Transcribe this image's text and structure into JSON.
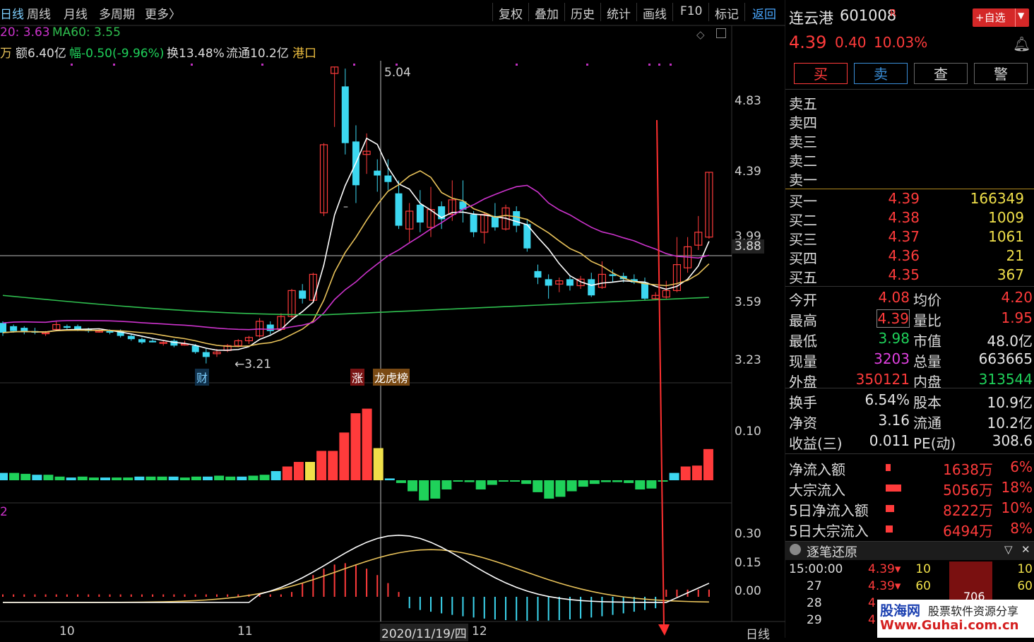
{
  "toolbar": {
    "tabs": [
      "日线",
      "周线",
      "月线",
      "多周期",
      "更多〉"
    ],
    "right_buttons": [
      "复权",
      "叠加",
      "历史",
      "统计",
      "画线",
      "F10",
      "标记",
      "返回"
    ]
  },
  "indicators": {
    "ma20": "20: 3.63",
    "ma60": "MA60: 3.55",
    "vol_prefix": "万",
    "amount": "额6.40亿",
    "change": "幅-0.50(-9.96%)",
    "turnover": "换13.48%",
    "float": "流通10.2亿",
    "sector": "港口",
    "sub_label": "2"
  },
  "chart_labels": {
    "high_label": "5.04",
    "low_label": "←3.21",
    "crosshair_price": "3.88",
    "crosshair_date": "2020/11/19/四",
    "tag_cai": "财",
    "tag_zhang": "涨",
    "tag_longbang": "龙虎榜",
    "dash_mark": "–"
  },
  "price_axis": [
    "4.83",
    "4.39",
    "3.99",
    "3.59",
    "3.23"
  ],
  "vol_axis": [
    "0.10"
  ],
  "macd_axis": [
    "0.30",
    "0.15",
    "0.00"
  ],
  "time_axis": {
    "m10": "10",
    "m11": "11",
    "m12": "12",
    "period": "日线"
  },
  "stock": {
    "name": "连云港",
    "code": "601008",
    "r_mark": "R",
    "price": "4.39",
    "change": "0.40",
    "pct": "10.03%",
    "watch_btn": "+自选"
  },
  "order_buttons": [
    "买",
    "卖",
    "查",
    "警"
  ],
  "asks": [
    {
      "label": "卖五",
      "price": "",
      "vol": ""
    },
    {
      "label": "卖四",
      "price": "",
      "vol": ""
    },
    {
      "label": "卖三",
      "price": "",
      "vol": ""
    },
    {
      "label": "卖二",
      "price": "",
      "vol": ""
    },
    {
      "label": "卖一",
      "price": "",
      "vol": ""
    }
  ],
  "bids": [
    {
      "label": "买一",
      "price": "4.39",
      "vol": "166349"
    },
    {
      "label": "买二",
      "price": "4.38",
      "vol": "1009"
    },
    {
      "label": "买三",
      "price": "4.37",
      "vol": "1061"
    },
    {
      "label": "买四",
      "price": "4.36",
      "vol": "21"
    },
    {
      "label": "买五",
      "price": "4.35",
      "vol": "367"
    }
  ],
  "quote": [
    {
      "l1": "今开",
      "v1": "4.08",
      "c1": "red",
      "l2": "均价",
      "v2": "4.20",
      "c2": "red"
    },
    {
      "l1": "最高",
      "v1": "4.39",
      "c1": "red",
      "l2": "量比",
      "v2": "1.95",
      "c2": "red"
    },
    {
      "l1": "最低",
      "v1": "3.98",
      "c1": "green",
      "l2": "市值",
      "v2": "48.0亿",
      "c2": "wht"
    },
    {
      "l1": "现量",
      "v1": "3203",
      "c1": "mag",
      "l2": "总量",
      "v2": "663665",
      "c2": "wht"
    },
    {
      "l1": "外盘",
      "v1": "350121",
      "c1": "red",
      "l2": "内盘",
      "v2": "313544",
      "c2": "green"
    }
  ],
  "fundamentals": [
    {
      "l1": "换手",
      "v1": "6.54%",
      "l2": "股本",
      "v2": "10.9亿"
    },
    {
      "l1": "净资",
      "v1": "3.16",
      "l2": "流通",
      "v2": "10.2亿"
    },
    {
      "l1": "收益(三)",
      "v1": "0.011",
      "l2": "PE(动)",
      "v2": "308.6"
    }
  ],
  "flows": [
    {
      "label": "净流入额",
      "value": "1638万",
      "pct": "6%",
      "bar": 0.06
    },
    {
      "label": "大宗流入",
      "value": "5056万",
      "pct": "18%",
      "bar": 0.18
    },
    {
      "label": "5日净流入额",
      "value": "8222万",
      "pct": "10%",
      "bar": 0.1
    },
    {
      "label": "5日大宗流入",
      "value": "6494万",
      "pct": "8%",
      "bar": 0.08
    }
  ],
  "ticks_header": "逐笔还原",
  "ticks": [
    {
      "time": "15:00:00",
      "price": "4.39",
      "vol": "10",
      "vol2": "10"
    },
    {
      "time": "27",
      "price": "4.39",
      "vol": "60",
      "vol2": "60"
    },
    {
      "time": "28",
      "price": "4",
      "vol": "",
      "vol2": ""
    },
    {
      "time": "29",
      "price": "4",
      "vol": "",
      "vol2": ""
    }
  ],
  "tick_block": "706",
  "watermark": {
    "line1": "股海网",
    "line1b": "股票软件资源分享",
    "line2": "Www.Guhai.com.cn"
  },
  "colors": {
    "up": "#ff3b3b",
    "down": "#3cd7f0",
    "ma5": "#ffffff",
    "ma10": "#e8c25a",
    "ma20": "#cc33cc",
    "ma60": "#2fbf4f",
    "neutral": "#f0e04a"
  }
}
